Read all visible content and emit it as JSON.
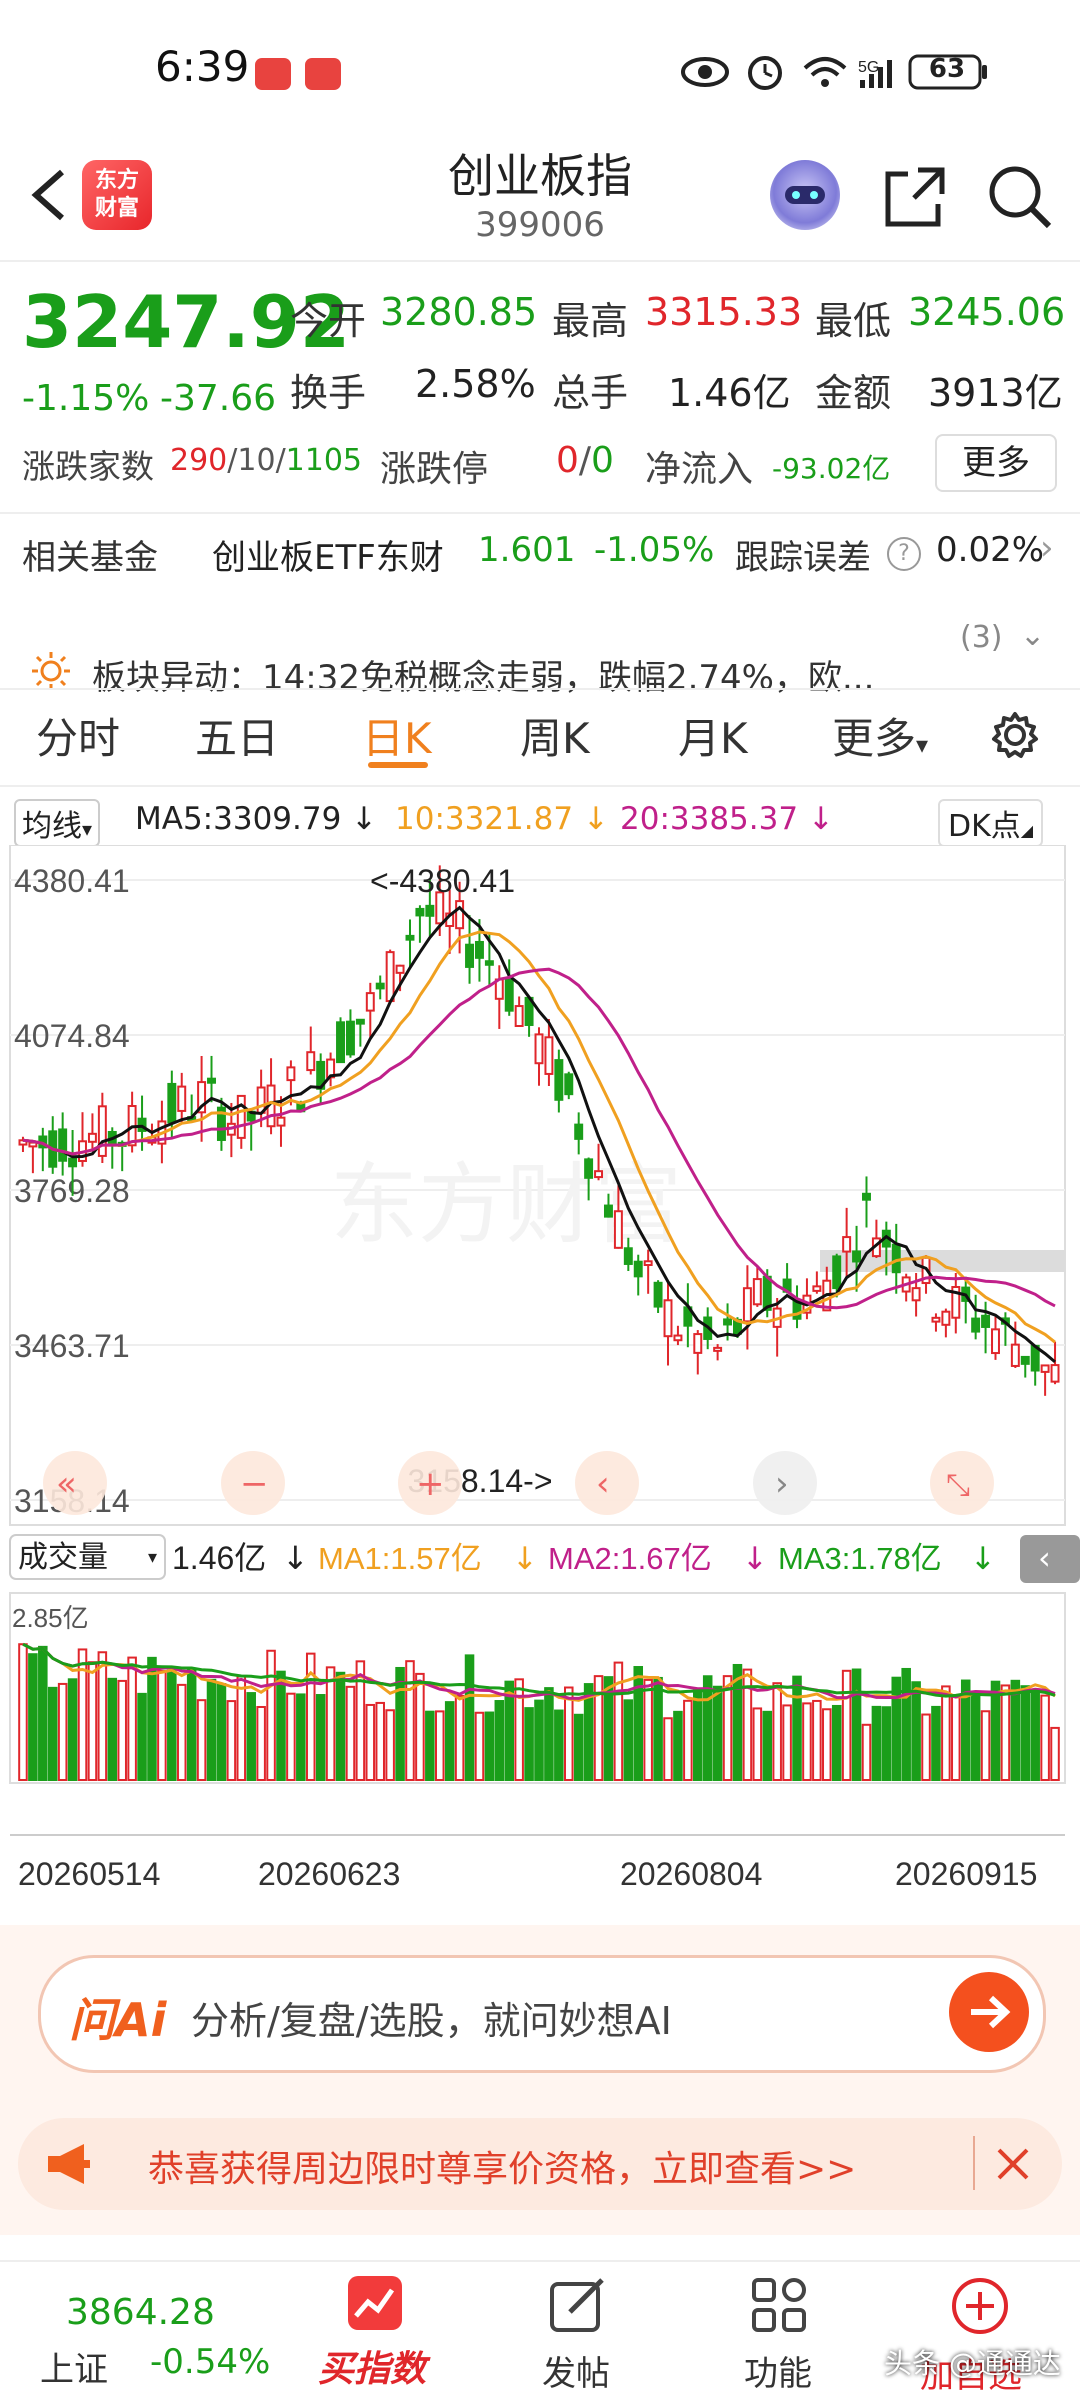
{
  "status_bar": {
    "time": "6:39",
    "network": "5G",
    "battery": "63"
  },
  "header": {
    "title": "创业板指",
    "code": "399006",
    "logo_text": "东方\n财富"
  },
  "quote": {
    "price": "3247.92",
    "change_pct": "-1.15%",
    "change_abs": "-37.66",
    "open_label": "今开",
    "open": "3280.85",
    "high_label": "最高",
    "high": "3315.33",
    "low_label": "最低",
    "low": "3245.06",
    "turnover_label": "换手",
    "turnover": "2.58%",
    "volume_label": "总手",
    "volume": "1.46亿",
    "amount_label": "金额",
    "amount": "3913亿",
    "updown_label": "涨跌家数",
    "up_count": "290",
    "flat_count": "10",
    "down_count": "1105",
    "limit_label": "涨跌停",
    "limit_up": "0",
    "limit_down": "0",
    "netflow_label": "净流入",
    "netflow": "-93.02亿",
    "more_label": "更多"
  },
  "fund": {
    "label": "相关基金",
    "name": "创业板ETF东财",
    "price": "1.601",
    "change": "-1.05%",
    "error_label": "跟踪误差",
    "error": "0.02%"
  },
  "ticker": {
    "text": "板块异动：14:32免税概念走弱，跌幅2.74%，欧...",
    "count": "(3)"
  },
  "tabs": [
    "分时",
    "五日",
    "日K",
    "周K",
    "月K",
    "更多"
  ],
  "active_tab": "日K",
  "ma": {
    "selector": "均线",
    "ma5": "MA5:3309.79",
    "ma10": "10:3321.87",
    "ma20": "20:3385.37",
    "dk": "DK点"
  },
  "chart_data": {
    "type": "candlestick",
    "y_labels": [
      "4380.41",
      "4074.84",
      "3769.28",
      "3463.71",
      "3158.14"
    ],
    "high_annotation": "4380.41",
    "low_annotation": "3158.14",
    "x_labels": [
      "20260514",
      "20260623",
      "20260804",
      "20260915"
    ],
    "ylim": [
      3158.14,
      4380.41
    ],
    "volume_selector": "成交量",
    "volume": "1.46亿",
    "vol_ma1": "MA1:1.57亿",
    "vol_ma2": "MA2:1.67亿",
    "vol_ma3": "MA3:1.78亿",
    "vol_top_label": "2.85亿",
    "colors": {
      "up": "#e0262b",
      "down": "#1a9e1a",
      "ma5": "#111111",
      "ma10": "#f0a020",
      "ma20": "#c0208a",
      "ma3": "#1a9e1a"
    }
  },
  "ai_bar": {
    "brand": "问Ai",
    "text": "分析/复盘/选股，就问妙想AI"
  },
  "banner": {
    "text": "恭喜获得周边限时尊享价资格，立即查看>>"
  },
  "bottom_nav": {
    "index_value": "3864.28",
    "index_name": "上证",
    "index_change": "-0.54%",
    "items": [
      "买指数",
      "发帖",
      "功能",
      "加自选"
    ],
    "watermark": "头条 @通通达"
  }
}
